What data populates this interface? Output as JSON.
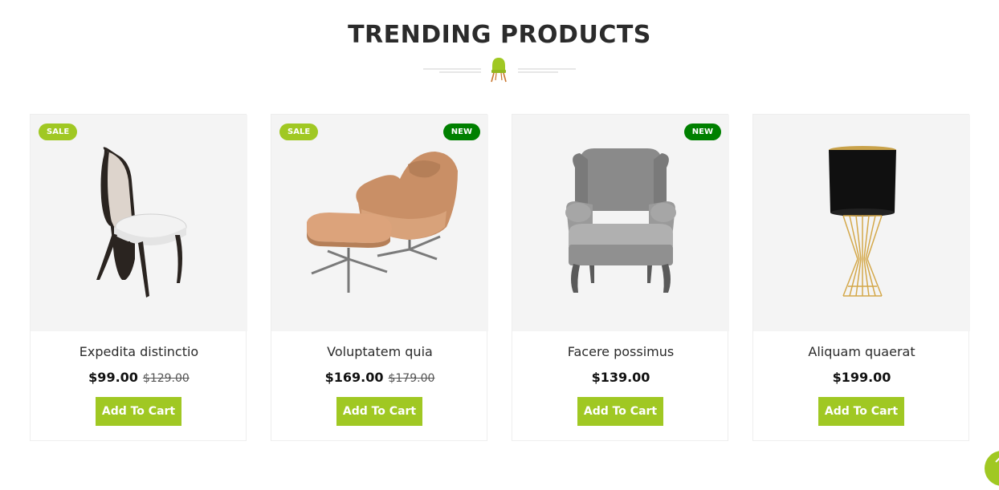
{
  "section": {
    "title": "TRENDING PRODUCTS"
  },
  "icons": {
    "divider": "chair-icon",
    "scroll_top": "arrow-up-icon"
  },
  "colors": {
    "accent": "#a0c823",
    "new_badge": "#008000",
    "image_bg": "#f4f4f4"
  },
  "products": [
    {
      "name": "Expedita distinctio",
      "price": "$99.00",
      "old_price": "$129.00",
      "badges": {
        "sale": "SALE",
        "new": ""
      },
      "button": "Add To Cart",
      "image": "black-white-accent-chair"
    },
    {
      "name": "Voluptatem quia",
      "price": "$169.00",
      "old_price": "$179.00",
      "badges": {
        "sale": "SALE",
        "new": "NEW"
      },
      "button": "Add To Cart",
      "image": "tan-lounge-chair-with-ottoman"
    },
    {
      "name": "Facere possimus",
      "price": "$139.00",
      "old_price": "",
      "badges": {
        "sale": "",
        "new": "NEW"
      },
      "button": "Add To Cart",
      "image": "grey-wingback-armchair"
    },
    {
      "name": "Aliquam quaerat",
      "price": "$199.00",
      "old_price": "",
      "badges": {
        "sale": "",
        "new": ""
      },
      "button": "Add To Cart",
      "image": "black-gold-table-lamp"
    }
  ]
}
